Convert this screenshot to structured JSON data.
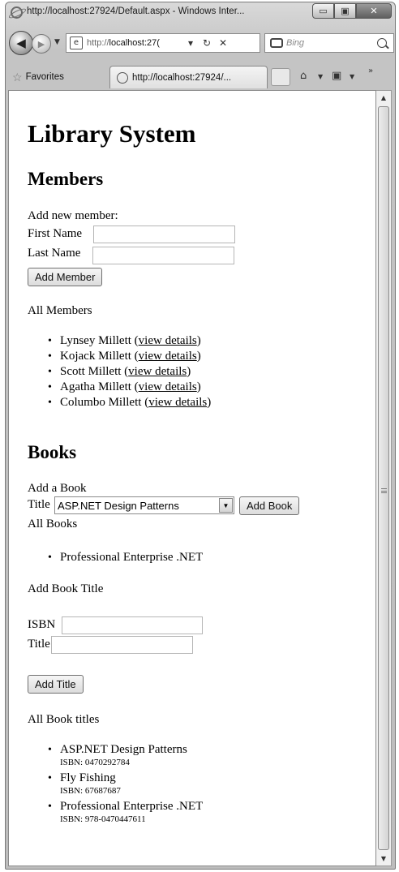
{
  "window": {
    "title": "http://localhost:27924/Default.aspx - Windows Inter...",
    "minimize_glyph": "▭",
    "restore_glyph": "▣",
    "close_glyph": "✕"
  },
  "navbar": {
    "address_prefix": "http://",
    "address_host": "localhost:27(",
    "refresh_glyph": "↻",
    "stop_glyph": "✕",
    "search_placeholder": "Bing"
  },
  "favorites_bar": {
    "favorites_label": "Favorites",
    "tab_title": "http://localhost:27924/..."
  },
  "page": {
    "title": "Library System",
    "members": {
      "heading": "Members",
      "add_label": "Add new member:",
      "first_name_label": "First Name",
      "last_name_label": "Last Name",
      "first_name_value": "",
      "last_name_value": "",
      "add_button": "Add Member",
      "all_label": "All Members",
      "list": [
        {
          "name": "Lynsey Millett",
          "link": "view details"
        },
        {
          "name": "Kojack Millett",
          "link": "view details"
        },
        {
          "name": "Scott Millett",
          "link": "view details"
        },
        {
          "name": "Agatha Millett",
          "link": "view details"
        },
        {
          "name": "Columbo Millett",
          "link": "view details"
        }
      ]
    },
    "books": {
      "heading": "Books",
      "add_label": "Add a Book",
      "title_label": "Title",
      "title_selected": "ASP.NET Design Patterns",
      "add_button": "Add Book",
      "all_label": "All Books",
      "list": [
        "Professional Enterprise .NET"
      ],
      "add_title_label": "Add Book Title",
      "isbn_label": "ISBN",
      "book_title_label": "Title",
      "isbn_value": "",
      "book_title_value": "",
      "add_title_button": "Add Title",
      "all_titles_label": "All Book titles",
      "titles": [
        {
          "title": "ASP.NET Design Patterns",
          "isbn": "ISBN: 0470292784"
        },
        {
          "title": "Fly Fishing",
          "isbn": "ISBN: 67687687"
        },
        {
          "title": "Professional Enterprise .NET",
          "isbn": "ISBN: 978-0470447611"
        }
      ]
    }
  }
}
